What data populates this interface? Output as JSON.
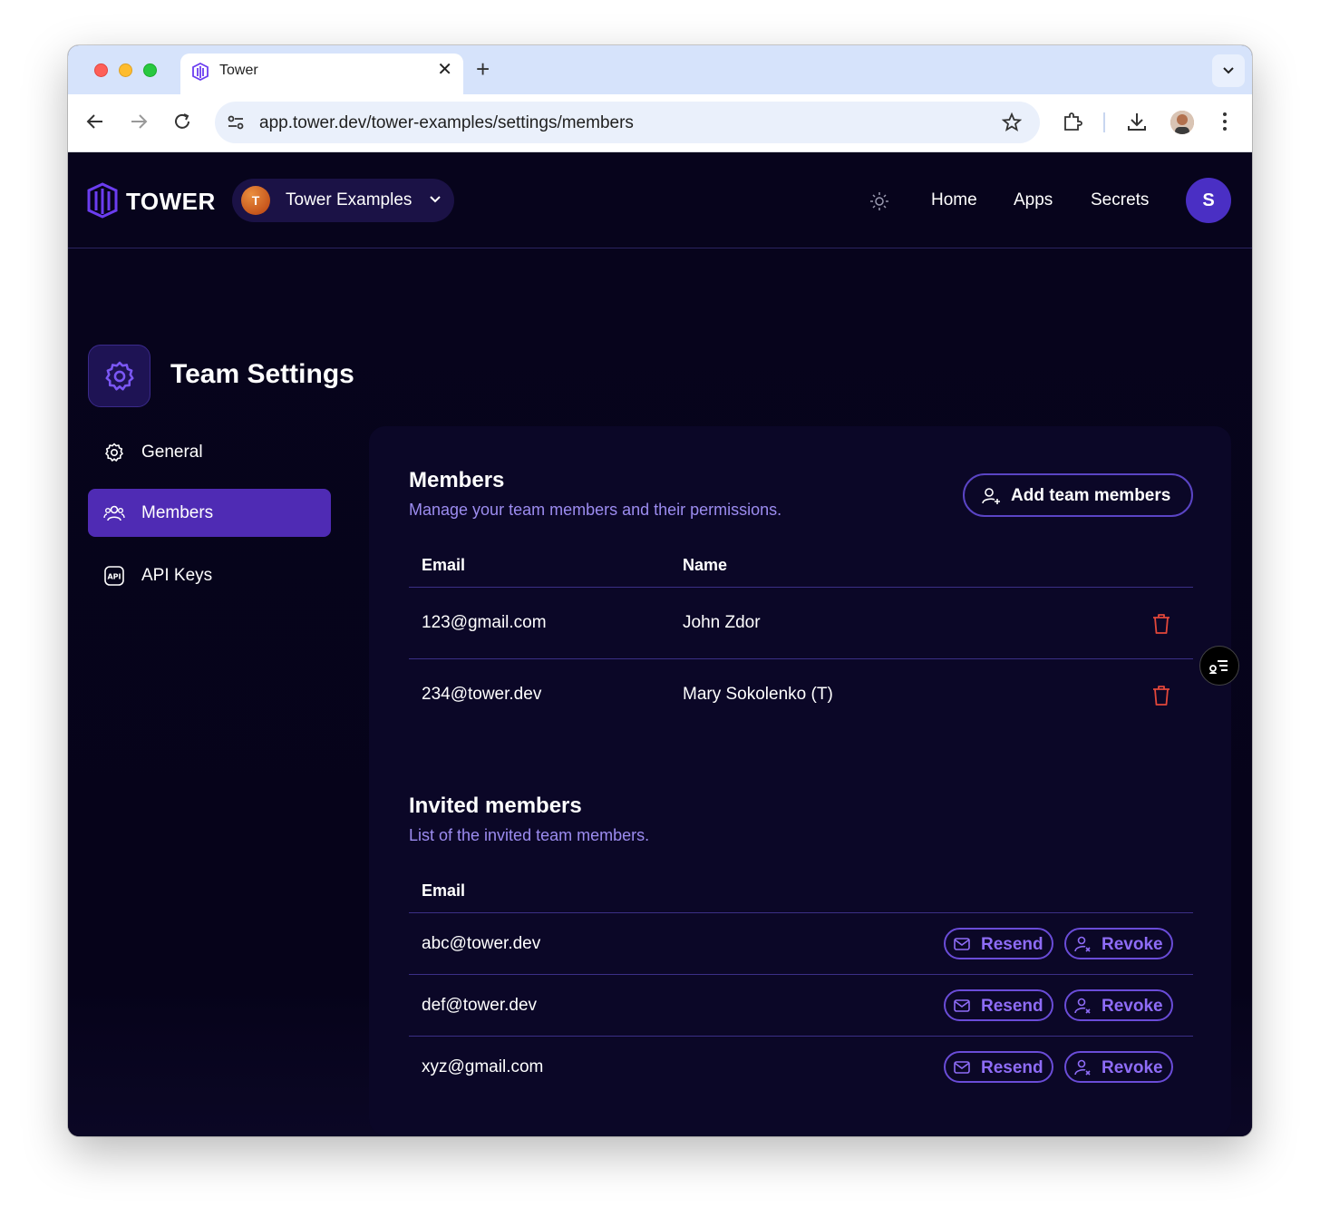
{
  "browser": {
    "tab_title": "Tower",
    "url": "app.tower.dev/tower-examples/settings/members"
  },
  "header": {
    "brand": "TOWER",
    "org_initial": "T",
    "org_name": "Tower Examples",
    "nav": [
      "Home",
      "Apps",
      "Secrets"
    ],
    "user_initial": "S"
  },
  "page": {
    "title": "Team Settings"
  },
  "sidebar": {
    "items": [
      {
        "label": "General",
        "icon": "gear-icon",
        "active": false
      },
      {
        "label": "Members",
        "icon": "users-icon",
        "active": true
      },
      {
        "label": "API Keys",
        "icon": "api-icon",
        "active": false
      }
    ]
  },
  "members": {
    "title": "Members",
    "subtitle": "Manage your team members and their permissions.",
    "add_button": "Add team members",
    "columns": [
      "Email",
      "Name"
    ],
    "rows": [
      {
        "email": "123@gmail.com",
        "name": "John Zdor"
      },
      {
        "email": "234@tower.dev",
        "name": "Mary Sokolenko (T)"
      }
    ]
  },
  "invited": {
    "title": "Invited members",
    "subtitle": "List of the invited team members.",
    "columns": [
      "Email"
    ],
    "resend_label": "Resend",
    "revoke_label": "Revoke",
    "rows": [
      {
        "email": "abc@tower.dev"
      },
      {
        "email": "def@tower.dev"
      },
      {
        "email": "xyz@gmail.com"
      }
    ]
  },
  "colors": {
    "background": "#07041c",
    "accent": "#4f2bb4",
    "subtitle": "#9c8cf0",
    "danger": "#e2473a",
    "button_text": "#8e6cf7"
  }
}
